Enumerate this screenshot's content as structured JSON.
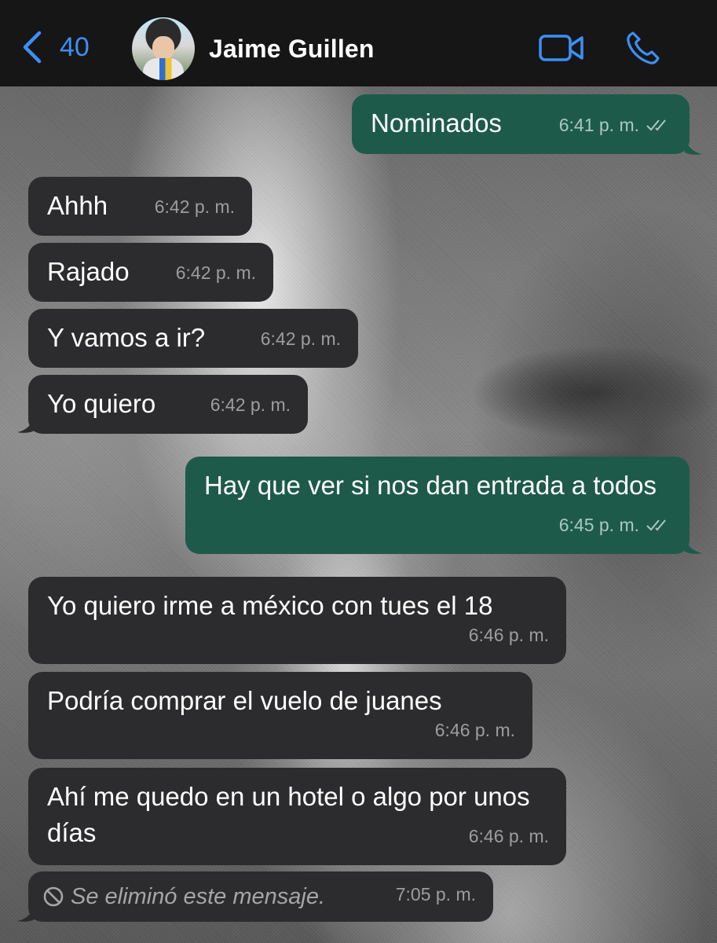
{
  "header": {
    "back_count": "40",
    "contact_name": "Jaime Guillen",
    "icons": {
      "back": "chevron-left-icon",
      "video": "video-camera-icon",
      "phone": "phone-icon"
    },
    "accent_color": "#3d8ff5"
  },
  "messages": [
    {
      "direction": "out",
      "text": "Nominados",
      "time": "6:41 p. m.",
      "read": true
    },
    {
      "direction": "in",
      "text": "Ahhh",
      "time": "6:42 p. m."
    },
    {
      "direction": "in",
      "text": "Rajado",
      "time": "6:42 p. m."
    },
    {
      "direction": "in",
      "text": "Y vamos a ir?",
      "time": "6:42 p. m."
    },
    {
      "direction": "in",
      "text": "Yo quiero",
      "time": "6:42 p. m."
    },
    {
      "direction": "out",
      "text": "Hay que ver si nos dan entrada a todos",
      "time": "6:45 p. m.",
      "read": true
    },
    {
      "direction": "in",
      "text": "Yo quiero irme a méxico con tues el 18",
      "time": "6:46 p. m."
    },
    {
      "direction": "in",
      "text": "Podría comprar el vuelo de juanes",
      "time": "6:46 p. m."
    },
    {
      "direction": "in",
      "text": "Ahí me quedo en un hotel o algo por unos días",
      "time": "6:46 p. m."
    },
    {
      "direction": "in",
      "text": "Se eliminó este mensaje.",
      "time": "7:05 p. m.",
      "deleted": true
    }
  ],
  "colors": {
    "incoming_bubble": "#2c2c2e",
    "outgoing_bubble": "#1e5a4a",
    "header_bg": "#161616"
  }
}
